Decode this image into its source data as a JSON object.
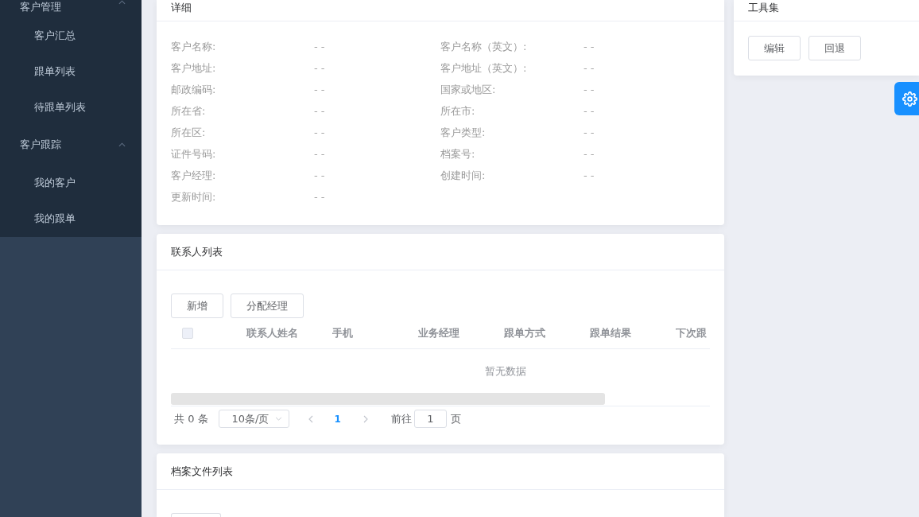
{
  "sidebar": {
    "groups": [
      {
        "title": "客户管理",
        "expanded": true,
        "items": [
          {
            "label": "客户汇总",
            "selected": false
          },
          {
            "label": "跟单列表",
            "selected": false
          },
          {
            "label": "待跟单列表",
            "selected": false
          }
        ]
      },
      {
        "title": "客户跟踪",
        "expanded": true,
        "items": [
          {
            "label": "我的客户",
            "selected": false
          },
          {
            "label": "我的跟单",
            "selected": false
          }
        ]
      }
    ]
  },
  "detail": {
    "title": "详细",
    "fields": [
      {
        "label": "客户名称:",
        "value": "- -"
      },
      {
        "label": "客户名称（英文）:",
        "value": "- -"
      },
      {
        "label": "客户地址:",
        "value": "- -"
      },
      {
        "label": "客户地址（英文）:",
        "value": "- -"
      },
      {
        "label": "邮政编码:",
        "value": "- -"
      },
      {
        "label": "国家或地区:",
        "value": "- -"
      },
      {
        "label": "所在省:",
        "value": "- -"
      },
      {
        "label": "所在市:",
        "value": "- -"
      },
      {
        "label": "所在区:",
        "value": "- -"
      },
      {
        "label": "客户类型:",
        "value": "- -"
      },
      {
        "label": "证件号码:",
        "value": "- -"
      },
      {
        "label": "档案号:",
        "value": "- -"
      },
      {
        "label": "客户经理:",
        "value": "- -"
      },
      {
        "label": "创建时间:",
        "value": "- -"
      },
      {
        "label": "更新时间:",
        "value": "- -"
      }
    ]
  },
  "toolbox": {
    "title": "工具集",
    "buttons": [
      "编辑",
      "回退"
    ]
  },
  "contacts": {
    "title": "联系人列表",
    "buttons": [
      "新增",
      "分配经理"
    ],
    "table": {
      "select_all_checked": false,
      "columns": [
        "联系人姓名",
        "手机",
        "业务经理",
        "跟单方式",
        "跟单结果",
        "下次跟"
      ],
      "empty_text": "暂无数据"
    },
    "pagination": {
      "total": "共 0 条",
      "page_size": "10条/页",
      "pages": [
        {
          "label": "1",
          "selected": true
        }
      ],
      "goto_label": "前往",
      "goto_value": "1",
      "page_suffix": "页"
    }
  },
  "archive": {
    "title": "档案文件列表"
  }
}
